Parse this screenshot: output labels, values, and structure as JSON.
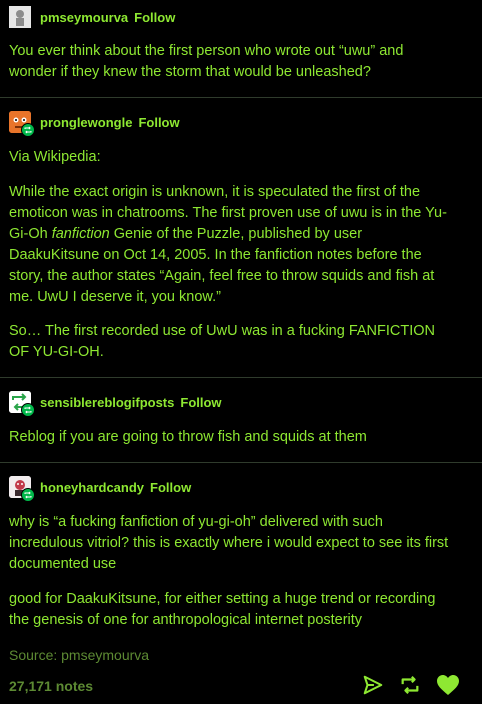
{
  "posts": [
    {
      "username": "pmseymourva",
      "follow_label": "Follow",
      "paragraphs": [
        "You ever think about the first person who wrote out “uwu” and wonder if they knew the storm that would be unleashed?"
      ]
    },
    {
      "username": "pronglewongle",
      "follow_label": "Follow",
      "p1": "Via Wikipedia:",
      "p2_a": "While the exact origin is unknown, it is speculated the first of the emoticon was in chatrooms. The first proven use of uwu is in the Yu-Gi-Oh ",
      "p2_em": "fanfiction",
      "p2_b": " Genie of the Puzzle, published by user DaakuKitsune on Oct 14, 2005. In the fanfiction notes before the story, the author states “Again, feel free to throw squids and fish at me. UwU I deserve it, you know.”",
      "p3": "So… The first recorded use of UwU was in a fucking FANFICTION OF YU-GI-OH."
    },
    {
      "username": "sensiblereblogifposts",
      "follow_label": "Follow",
      "p1": "Reblog if you are going to throw fish and squids at them"
    },
    {
      "username": "honeyhardcandy",
      "follow_label": "Follow",
      "p1": "why is “a fucking fanfiction of yu-gi-oh” delivered with such incredulous vitriol? this is exactly where i would expect to see its first documented use",
      "p2": "good for DaakuKitsune, for either setting a huge trend or recording the genesis of one for anthropological internet posterity"
    }
  ],
  "source_label": "Source: pmseymourva",
  "notes_label": "27,171 notes",
  "icons": {
    "share": "paper-plane-icon",
    "reblog": "reblog-icon",
    "like": "heart-icon"
  },
  "colors": {
    "background": "#000000",
    "text": "#8ee832",
    "muted": "#5d8a33",
    "divider": "#2f3b2c",
    "reblog_badge": "#00b84a"
  }
}
